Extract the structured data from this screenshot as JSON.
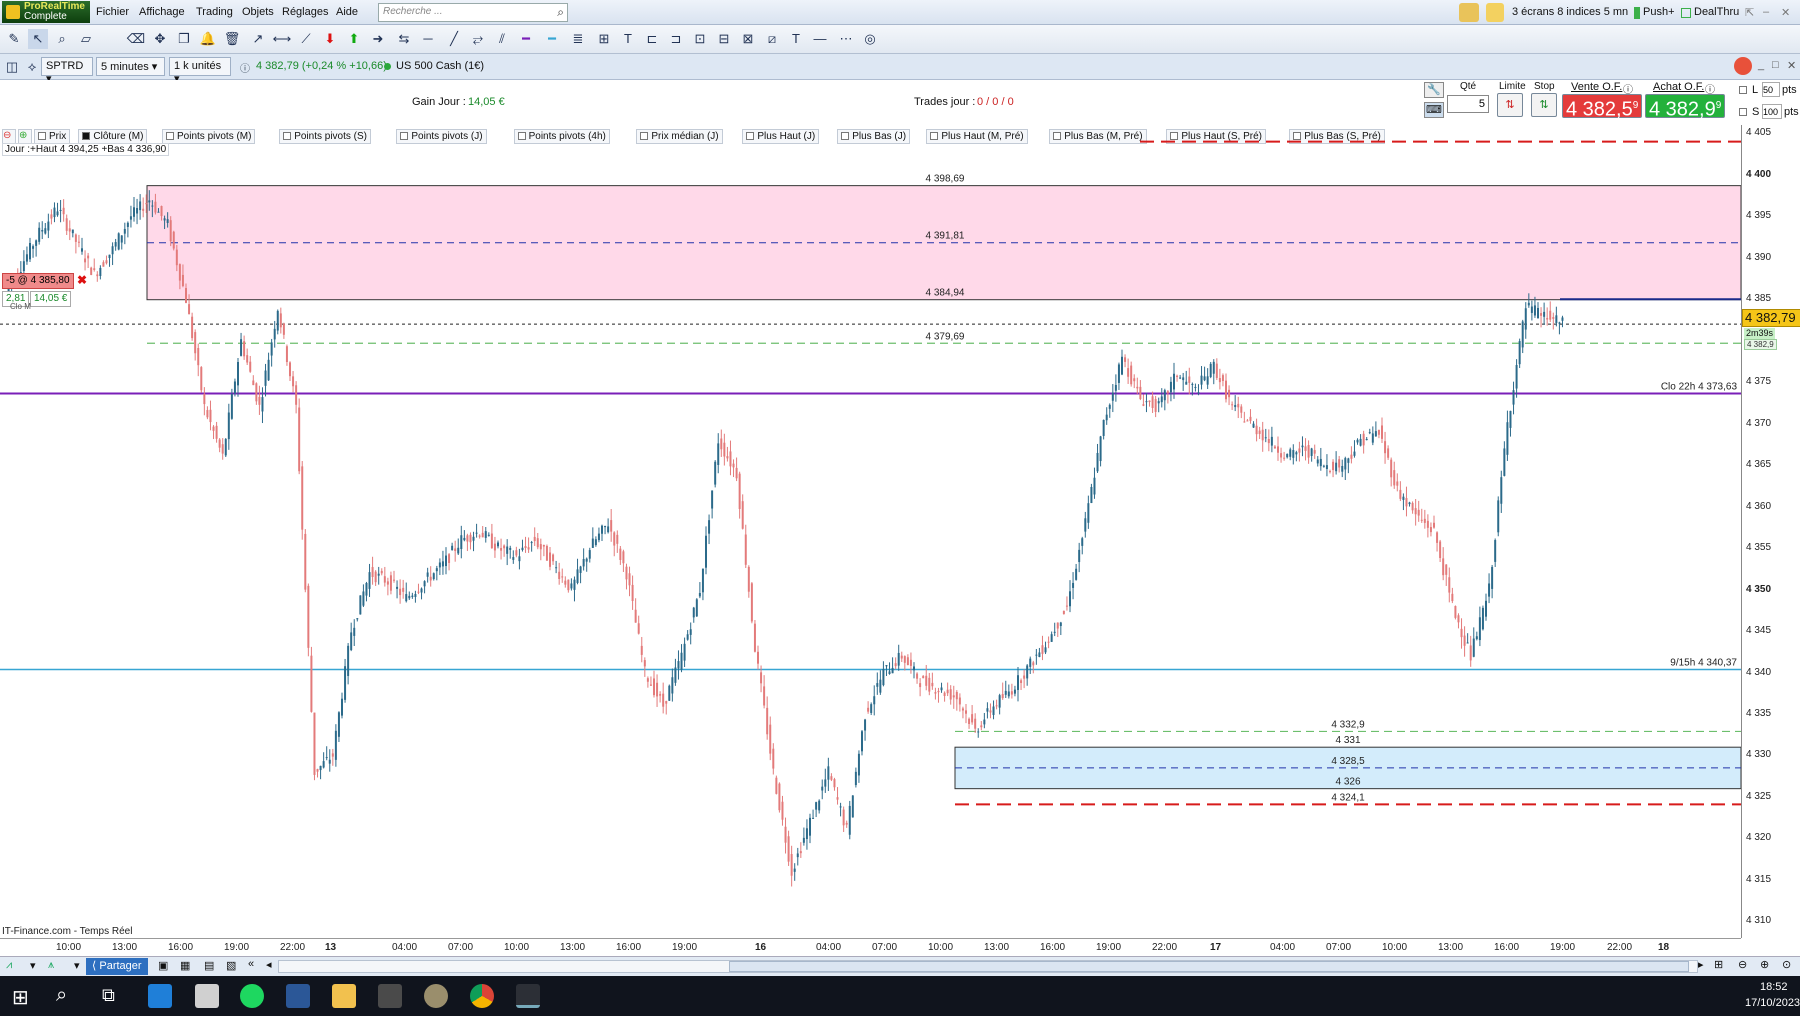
{
  "app": {
    "logo_line1": "ProRealTime",
    "logo_line2": "Complete"
  },
  "menu": {
    "items": [
      "Fichier",
      "Affichage",
      "Trading",
      "Objets",
      "Réglages",
      "Aide"
    ],
    "search_placeholder": "Recherche ...",
    "layout_label": "3 écrans 8 indices 5 mn",
    "push_label": "Push+",
    "dealthru_label": "DealThru"
  },
  "instrument": {
    "symbol": "SPTRD",
    "timeframe": "5 minutes",
    "units": "1 k unités",
    "quote": "4 382,79 (+0,24 % +10,66)",
    "name": "US 500 Cash (1€)"
  },
  "stats": {
    "gain_label": "Gain Jour :",
    "gain_value": "14,05 €",
    "trades_label": "Trades jour :",
    "trades_value": "0 / 0 / 0"
  },
  "order": {
    "qty_label": "Qté",
    "qty_value": "5",
    "limit_label": "Limite",
    "stop_label": "Stop",
    "sell_label": "Vente O.F.",
    "buy_label": "Achat O.F.",
    "sell_price": "4 382,5",
    "sell_sup": "9",
    "buy_price": "4 382,9",
    "buy_sup": "9",
    "l_label": "L",
    "l_value": "50",
    "s_label": "S",
    "s_value": "100",
    "pts": "pts"
  },
  "indicators": [
    "Prix",
    "Clôture (M)",
    "Points pivots (M)",
    "Points pivots (S)",
    "Points pivots (J)",
    "Points pivots (4h)",
    "Prix médian (J)",
    "Plus Haut (J)",
    "Plus Bas (J)",
    "Plus Haut (M, Pré)",
    "Plus Bas (M, Pré)",
    "Plus Haut (S, Pré)",
    "Plus Bas (S, Pré)"
  ],
  "chart_info": {
    "day_range": "Jour :+Haut 4 394,25 +Bas 4 336,90",
    "source": "IT-Finance.com - Temps Réel",
    "position_label": "-5 @ 4 385,80",
    "pnl_pts": "2,81",
    "pnl_eur": "14,05 €",
    "clo_small": "Clo M"
  },
  "chart_data": {
    "type": "line",
    "subtype": "candlestick-5min",
    "ylim": [
      4308,
      4406
    ],
    "price_ticks": [
      "4 405",
      "4 400",
      "4 395",
      "4 390",
      "4 385",
      "4 380",
      "4 375",
      "4 370",
      "4 365",
      "4 360",
      "4 355",
      "4 350",
      "4 345",
      "4 340",
      "4 335",
      "4 330",
      "4 325",
      "4 320",
      "4 315",
      "4 310"
    ],
    "time_ticks": [
      "10:00",
      "13:00",
      "16:00",
      "19:00",
      "22:00",
      "13",
      "04:00",
      "07:00",
      "10:00",
      "13:00",
      "16:00",
      "19:00",
      "16",
      "04:00",
      "07:00",
      "10:00",
      "13:00",
      "16:00",
      "19:00",
      "22:00",
      "17",
      "04:00",
      "07:00",
      "10:00",
      "13:00",
      "16:00",
      "19:00",
      "22:00",
      "18"
    ],
    "series": [
      {
        "values": [
          4385,
          4389,
          4393,
          4396,
          4392,
          4388,
          4391,
          4395,
          4397,
          4394,
          4385,
          4372,
          4366,
          4380,
          4372,
          4384,
          4372,
          4328,
          4330,
          4345,
          4352,
          4351,
          4349,
          4351,
          4353,
          4356,
          4357,
          4355,
          4354,
          4356,
          4353,
          4350,
          4355,
          4358,
          4352,
          4340,
          4336,
          4342,
          4350,
          4368,
          4364,
          4343,
          4328,
          4316,
          4322,
          4328,
          4321,
          4335,
          4340,
          4342,
          4339,
          4338,
          4337,
          4333,
          4336,
          4338,
          4341,
          4344,
          4348,
          4358,
          4370,
          4378,
          4373,
          4372,
          4376,
          4374,
          4377,
          4372,
          4370,
          4368,
          4366,
          4367,
          4365,
          4365,
          4368,
          4369,
          4362,
          4359,
          4357,
          4348,
          4342,
          4350,
          4370,
          4384,
          4383,
          4382
        ]
      }
    ],
    "zones": [
      {
        "top": 4398.69,
        "bottom": 4384.94,
        "mid": 4391.81
      },
      {
        "top": 4331,
        "bottom": 4326,
        "mid": 4328.5
      }
    ],
    "levels": [
      {
        "value": 4404,
        "label": ""
      },
      {
        "value": 4398.69,
        "label": "4 398,69"
      },
      {
        "value": 4391.81,
        "label": "4 391,81"
      },
      {
        "value": 4384.94,
        "label": "4 384,94"
      },
      {
        "value": 4379.69,
        "label": "4 379,69"
      },
      {
        "value": 4373.63,
        "label": "Clo 22h 4 373,63"
      },
      {
        "value": 4340.37,
        "label": "9/15h 4 340,37"
      },
      {
        "value": 4332.9,
        "label": "4 332,9"
      },
      {
        "value": 4331,
        "label": "4 331"
      },
      {
        "value": 4328.5,
        "label": "4 328,5"
      },
      {
        "value": 4326,
        "label": "4 326"
      },
      {
        "value": 4324.1,
        "label": "4 324,1"
      }
    ],
    "last_price": "4 382,79",
    "countdown": "2m39s",
    "mini_tag": "4 382,9"
  },
  "bottom": {
    "share": "Partager",
    "clock": "18:52",
    "date": "17/10/2023"
  },
  "colors": {
    "up": "#2b6a8a",
    "down": "#e37a7a",
    "pink_zone": "#ffd9e9",
    "blue_zone": "#d3ecfb",
    "purple": "#7a1fb8",
    "cyan": "#37a6d3",
    "red_dash": "#d71b1b",
    "green_dash": "#6dbf6d",
    "navy_dash": "#2233aa",
    "sell": "#e43b3b",
    "buy": "#23b13b"
  }
}
